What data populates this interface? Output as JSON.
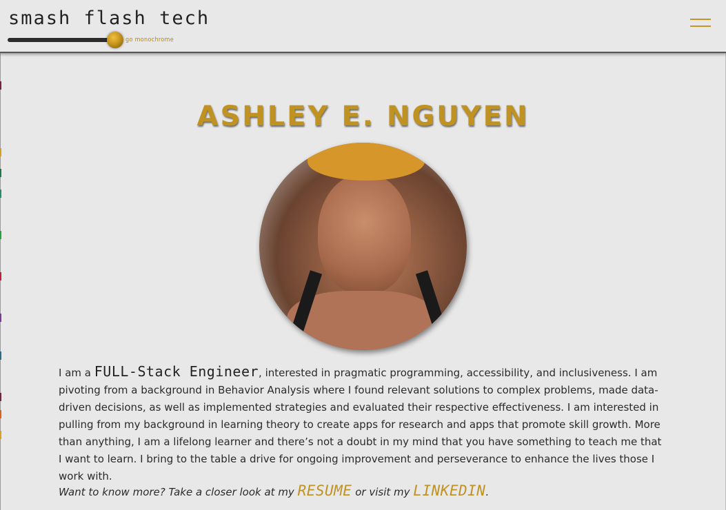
{
  "header": {
    "brand": "smash flash tech",
    "toggle_label": "go monochrome",
    "menu_icon": "hamburger-icon"
  },
  "colors": {
    "accent": "#c09222",
    "background": "#e8e8e8",
    "text": "#2a2a2a"
  },
  "main": {
    "name": "Ashley E. Nguyen",
    "portrait_alt": "portrait-photo",
    "bio": {
      "intro": "I am a",
      "role": "FULL-Stack Engineer",
      "rest": ", interested in pragmatic programming, accessibility, and inclusiveness. I am pivoting from a background in Behavior Analysis where I found relevant solutions to complex problems, made data-driven decisions, as well as implemented strategies and evaluated their respective effectiveness. I am interested in pulling from my background in learning theory to create apps for research and apps that promote skill growth. More than anything, I am a lifelong learner and there’s not a doubt in my mind that you have something to teach me that I want to learn. I bring to the table a drive for ongoing improvement and perseverance to enhance the lives those I work with."
    },
    "cta": {
      "lead": "Want to know more? Take a closer look at my",
      "resume_label": "resume",
      "middle": "or visit my",
      "linkedin_label": "LinkedIn",
      "end": "."
    }
  }
}
